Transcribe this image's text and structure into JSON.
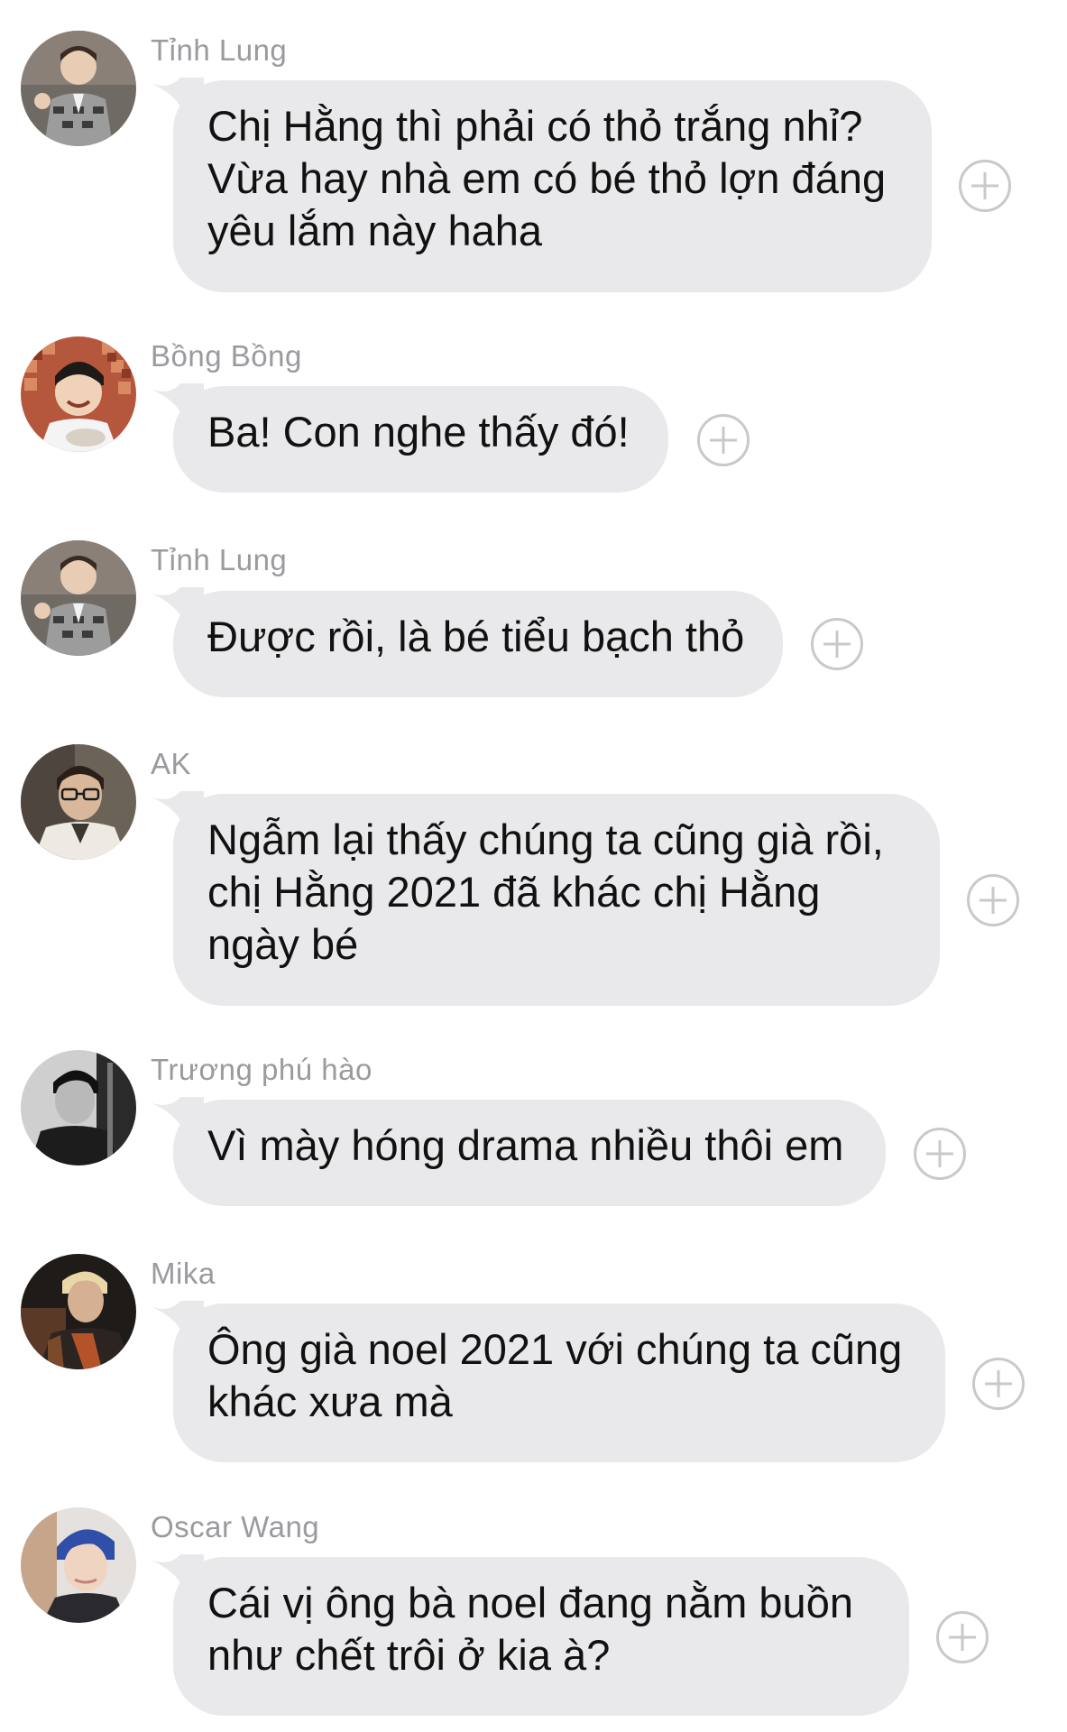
{
  "messages": [
    {
      "sender": "Tỉnh Lung",
      "text": "Chị Hằng thì phải có thỏ trắng nhỉ?\nVừa hay nhà em có bé thỏ lợn đáng\nyêu lắm này haha",
      "avatar_icon": "avatar-boy-checkered-shirt-icon"
    },
    {
      "sender": "Bồng Bồng",
      "text": "Ba! Con nghe thấy đó!",
      "avatar_icon": "avatar-child-icon"
    },
    {
      "sender": "Tỉnh Lung",
      "text": "Được rồi, là bé tiểu bạch thỏ",
      "avatar_icon": "avatar-boy-checkered-shirt-icon"
    },
    {
      "sender": "AK",
      "text": "Ngẫm lại thấy chúng ta cũng già rồi,\nchị Hằng 2021 đã khác chị Hằng\nngày bé",
      "avatar_icon": "avatar-man-glasses-icon"
    },
    {
      "sender": "Trương phú hào",
      "text": "Vì mày hóng drama nhiều thôi em",
      "avatar_icon": "avatar-man-monochrome-icon"
    },
    {
      "sender": "Mika",
      "text": "Ông già noel 2021 với chúng ta cũng\nkhác xưa mà",
      "avatar_icon": "avatar-man-blonde-icon"
    },
    {
      "sender": "Oscar Wang",
      "text": "Cái vị ông bà noel đang nằm buồn\nnhư chết trôi ở kia à?",
      "avatar_icon": "avatar-man-blue-hair-icon"
    }
  ],
  "colors": {
    "bubble": "#e9e9eb",
    "sender_name": "#9a9a9f",
    "text": "#111111",
    "plus_icon": "#c9c9cd"
  },
  "actions": {
    "reaction_icon": "plus-circle-icon"
  }
}
